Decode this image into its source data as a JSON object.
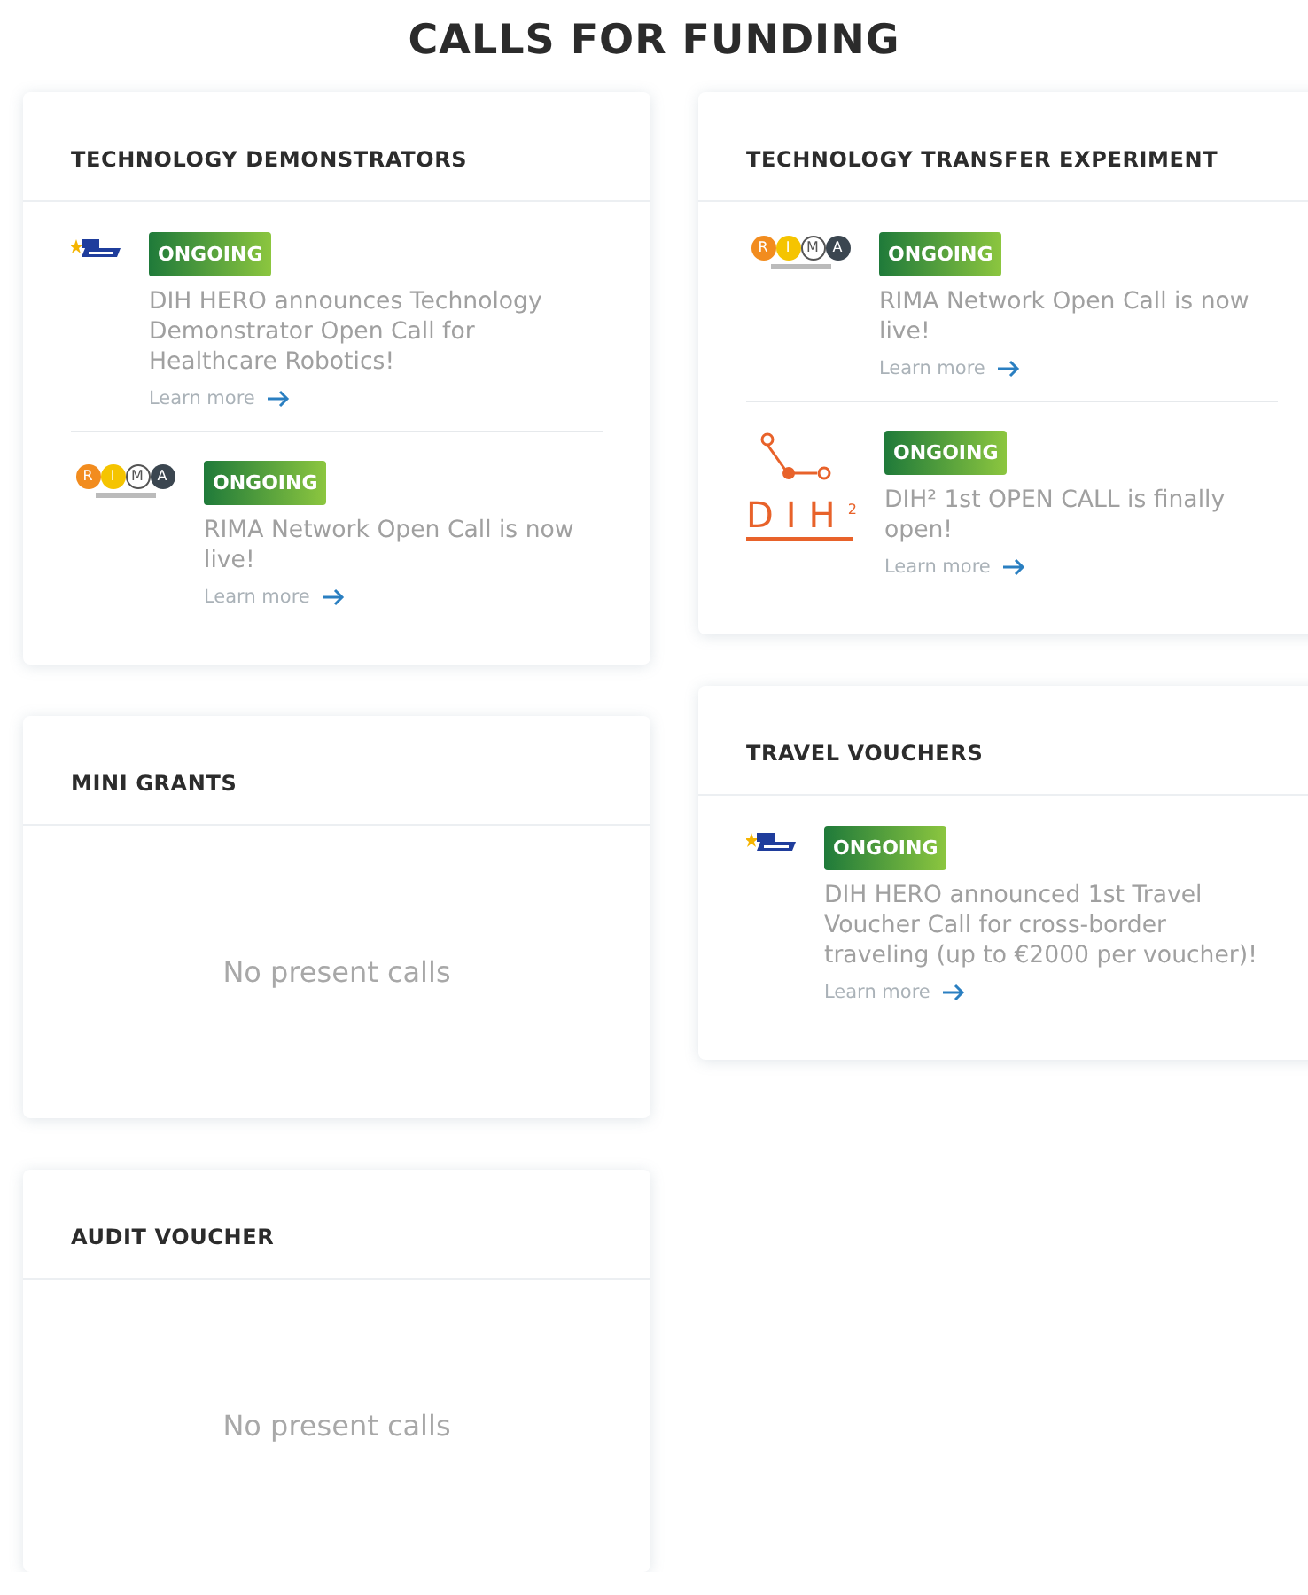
{
  "title": "CALLS FOR FUNDING",
  "columns": [
    {
      "cards": [
        {
          "title": "TECHNOLOGY DEMONSTRATORS",
          "items": [
            {
              "kind": "dihhero",
              "status": "ONGOING",
              "text": "DIH HERO announces Technology Demonstrator Open Call for Healthcare Robotics!",
              "link": "Learn more"
            },
            {
              "kind": "rima",
              "logo_text": "R I M A",
              "status": "ONGOING",
              "text": "RIMA Network Open Call is now live!",
              "link": "Learn more"
            }
          ]
        },
        {
          "title": "MINI GRANTS",
          "empty": "No present calls"
        },
        {
          "title": "AUDIT VOUCHER",
          "empty": "No present calls"
        }
      ]
    },
    {
      "cards": [
        {
          "title": "TECHNOLOGY TRANSFER EXPERIMENT",
          "items": [
            {
              "kind": "rima",
              "logo_text": "R I M A",
              "status": "ONGOING",
              "text": "RIMA Network Open Call is now live!",
              "link": "Learn more"
            },
            {
              "kind": "dih2",
              "logo_text": "DIH",
              "logo_sup": "2",
              "status": "ONGOING",
              "text": "DIH² 1st OPEN CALL is finally open!",
              "link": "Learn more"
            }
          ]
        },
        {
          "title": "TRAVEL VOUCHERS",
          "items": [
            {
              "kind": "dihhero",
              "status": "ONGOING",
              "text": "DIH HERO announced 1st Travel Voucher Call for cross-border traveling (up to €2000 per voucher)!",
              "link": "Learn more"
            }
          ]
        }
      ]
    }
  ]
}
